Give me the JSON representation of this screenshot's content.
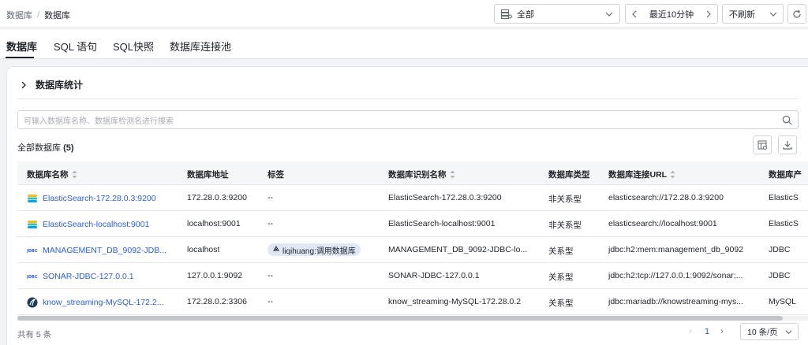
{
  "breadcrumb": {
    "root": "数据库",
    "separator": "/",
    "current": "数据库"
  },
  "filters": {
    "db_filter": "全部",
    "time_range": "最近10分钟",
    "refresh": "不刷新"
  },
  "tabs": [
    {
      "label": "数据库",
      "active": true
    },
    {
      "label": "SQL 语句",
      "active": false
    },
    {
      "label": "SQL快照",
      "active": false
    },
    {
      "label": "数据库连接池",
      "active": false
    }
  ],
  "stats": {
    "title": "数据库统计"
  },
  "search": {
    "placeholder": "可输入数据库名称、数据库检测名进行搜索"
  },
  "summary": {
    "label": "全部数据库",
    "count": "(5)"
  },
  "table": {
    "columns": [
      "数据库名称",
      "数据库地址",
      "标签",
      "数据库识别名称",
      "数据库类型",
      "数据库连接URL",
      "数据库产"
    ],
    "rows": [
      {
        "icon": "elasticsearch-icon",
        "name": "ElasticSearch-172.28.0.3:9200",
        "address": "172.28.0.3:9200",
        "tag": "--",
        "ident": "ElasticSearch-172.28.0.3:9200",
        "type": "非关系型",
        "url": "elasticsearch://172.28.0.3:9200",
        "product": "ElasticS"
      },
      {
        "icon": "elasticsearch-icon",
        "name": "ElasticSearch-localhost:9001",
        "address": "localhost:9001",
        "tag": "--",
        "ident": "ElasticSearch-localhost:9001",
        "type": "非关系型",
        "url": "elasticsearch://localhost:9001",
        "product": "ElasticS"
      },
      {
        "icon": "jdbc-icon",
        "name": "MANAGEMENT_DB_9092-JDB...",
        "address": "localhost",
        "tag": "liqihuang:调用数据库",
        "ident": "MANAGEMENT_DB_9092-JDBC-lo...",
        "type": "关系型",
        "url": "jdbc:h2:mem:management_db_9092",
        "product": "JDBC"
      },
      {
        "icon": "jdbc-icon",
        "name": "SONAR-JDBC-127.0.0.1",
        "address": "127.0.0.1:9092",
        "tag": "--",
        "ident": "SONAR-JDBC-127.0.0.1",
        "type": "关系型",
        "url": "jdbc:h2:tcp://127.0.0.1:9092/sonar;...",
        "product": "JDBC"
      },
      {
        "icon": "mysql-icon",
        "name": "know_streaming-MySQL-172.2...",
        "address": "172.28.0.2:3306",
        "tag": "--",
        "ident": "know_streaming-MySQL-172.28.0.2",
        "type": "关系型",
        "url": "jdbc:mariadb://knowstreaming-mys...",
        "product": "MySQL"
      }
    ]
  },
  "pagination": {
    "total": "共有 5 条",
    "prev": "‹",
    "page": "1",
    "next": "›",
    "page_size": "10 条/页"
  },
  "colors": {
    "link": "#2b5fd9",
    "tag_bg": "#e1e8f5",
    "header_bg": "#f5f6f7",
    "border": "#e5e6eb"
  }
}
